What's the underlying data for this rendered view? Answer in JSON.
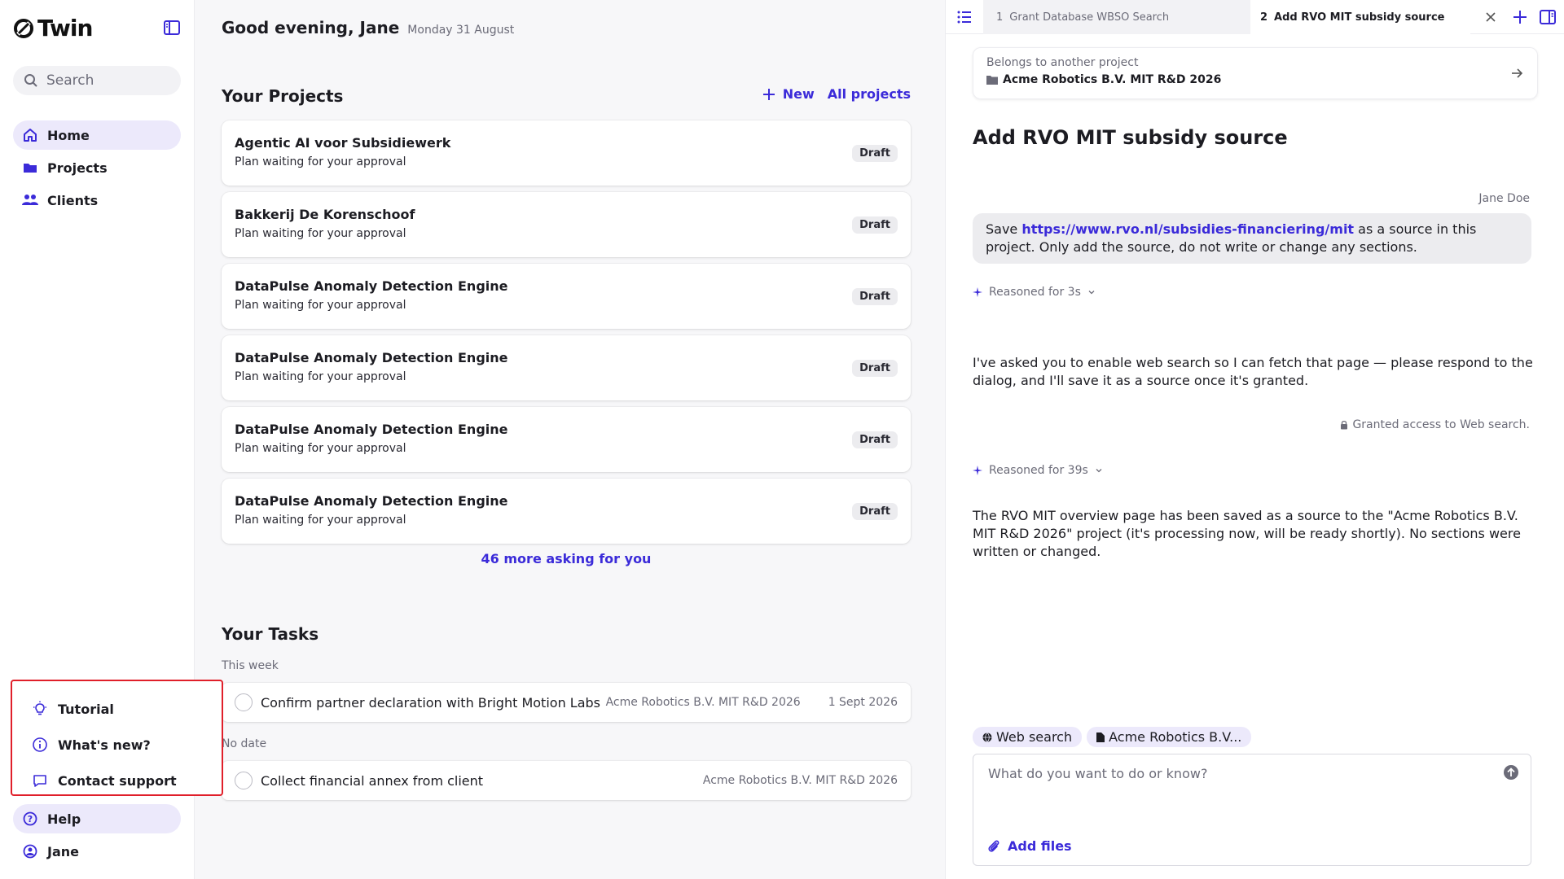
{
  "app": {
    "brand": "Twin",
    "accent": "#3b2bd9",
    "highlight_border": "#e01f2a"
  },
  "sidebar": {
    "search_placeholder": "Search",
    "items": [
      {
        "label": "Home",
        "icon": "home-icon",
        "active": true
      },
      {
        "label": "Projects",
        "icon": "folder-icon"
      },
      {
        "label": "Clients",
        "icon": "users-icon"
      }
    ],
    "help_menu": [
      {
        "label": "Tutorial",
        "icon": "lightbulb-icon"
      },
      {
        "label": "What's new?",
        "icon": "info-icon"
      },
      {
        "label": "Contact support",
        "icon": "chat-icon"
      }
    ],
    "bottom": [
      {
        "label": "Help",
        "icon": "help-icon"
      },
      {
        "label": "Jane",
        "icon": "user-icon"
      }
    ]
  },
  "main": {
    "greeting": "Good evening, Jane",
    "date": "Monday 31 August",
    "projects_title": "Your Projects",
    "new_label": "New",
    "all_projects_label": "All projects",
    "projects": [
      {
        "name": "Agentic AI voor Subsidiewerk",
        "subtitle": "Plan waiting for your approval",
        "status": "Draft"
      },
      {
        "name": "Bakkerij De Korenschoof",
        "subtitle": "Plan waiting for your approval",
        "status": "Draft"
      },
      {
        "name": "DataPulse Anomaly Detection Engine",
        "subtitle": "Plan waiting for your approval",
        "status": "Draft"
      },
      {
        "name": "DataPulse Anomaly Detection Engine",
        "subtitle": "Plan waiting for your approval",
        "status": "Draft"
      },
      {
        "name": "DataPulse Anomaly Detection Engine",
        "subtitle": "Plan waiting for your approval",
        "status": "Draft"
      },
      {
        "name": "DataPulse Anomaly Detection Engine",
        "subtitle": "Plan waiting for your approval",
        "status": "Draft"
      }
    ],
    "more_label": "46 more asking for you",
    "tasks_title": "Your Tasks",
    "task_groups": [
      {
        "label": "This week",
        "tasks": [
          {
            "title": "Confirm partner declaration with Bright Motion Labs",
            "project": "Acme Robotics B.V. MIT R&D 2026",
            "date": "1 Sept 2026"
          }
        ]
      },
      {
        "label": "No date",
        "tasks": [
          {
            "title": "Collect financial annex from client",
            "project": "Acme Robotics B.V. MIT R&D 2026",
            "date": ""
          }
        ]
      }
    ]
  },
  "panel": {
    "tabs": [
      {
        "num": "1",
        "label": "Grant Database WBSO Search"
      },
      {
        "num": "2",
        "label": "Add RVO MIT subsidy source"
      }
    ],
    "belongs_label": "Belongs to another project",
    "belongs_project": "Acme Robotics B.V. MIT R&D 2026",
    "title": "Add RVO MIT subsidy source",
    "sender": "Jane Doe",
    "user_msg_pre": "Save ",
    "user_msg_link": "https://www.rvo.nl/subsidies-financiering/mit",
    "user_msg_post": " as a source in this project. Only add the source, do not write or change any sections.",
    "reasoned_1": "Reasoned for 3s",
    "assistant_1": "I've asked you to enable web search so I can fetch that page — please respond to the dialog, and I'll save it as a source once it's granted.",
    "granted": "Granted access to Web search.",
    "reasoned_2": "Reasoned for 39s",
    "assistant_2": "The RVO MIT overview page has been saved as a source to the \"Acme Robotics B.V. MIT R&D 2026\" project (it's processing now, will be ready shortly). No sections were written or changed.",
    "chips": [
      {
        "label": "Web search",
        "icon": "globe-icon"
      },
      {
        "label": "Acme Robotics B.V...",
        "icon": "document-icon"
      }
    ],
    "composer_placeholder": "What do you want to do or know?",
    "add_files_label": "Add files"
  }
}
